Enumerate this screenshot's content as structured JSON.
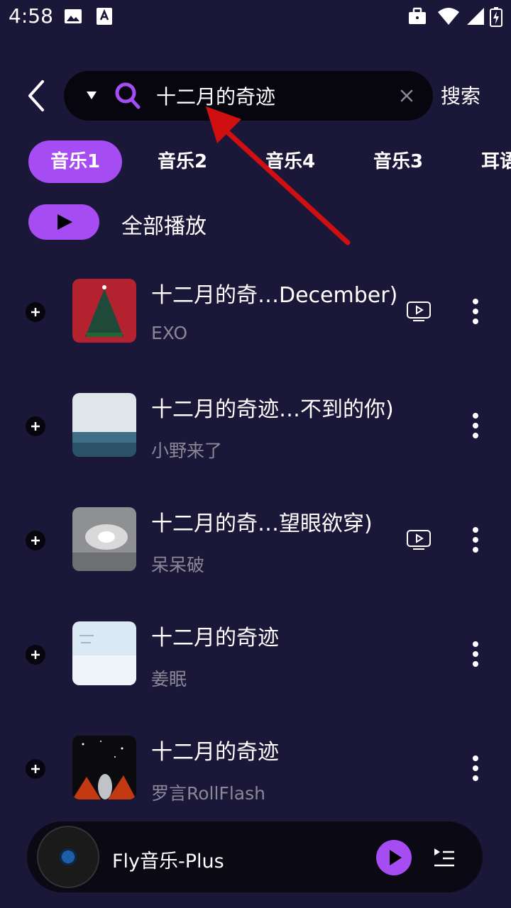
{
  "status_bar": {
    "time": "4:58"
  },
  "header": {
    "search_value": "十二月的奇迹",
    "search_button": "搜索"
  },
  "tabs": [
    {
      "label": "音乐1",
      "active": true
    },
    {
      "label": "音乐2",
      "active": false
    },
    {
      "label": "音乐4",
      "active": false
    },
    {
      "label": "音乐3",
      "active": false
    },
    {
      "label": "耳语",
      "active": false
    }
  ],
  "play_all": {
    "label": "全部播放"
  },
  "songs": [
    {
      "title": "十二月的奇…December)",
      "artist": "EXO",
      "has_mv": true
    },
    {
      "title": "十二月的奇迹…不到的你)",
      "artist": "小野来了",
      "has_mv": false
    },
    {
      "title": "十二月的奇…望眼欲穿)",
      "artist": "呆呆破",
      "has_mv": true
    },
    {
      "title": "十二月的奇迹",
      "artist": "姜眠",
      "has_mv": false
    },
    {
      "title": "十二月的奇迹",
      "artist": "罗言RollFlash",
      "has_mv": false
    }
  ],
  "player": {
    "title": "Fly音乐-Plus"
  },
  "colors": {
    "accent": "#a54df2",
    "background": "#1a1738",
    "annotation_arrow": "#d01010"
  }
}
